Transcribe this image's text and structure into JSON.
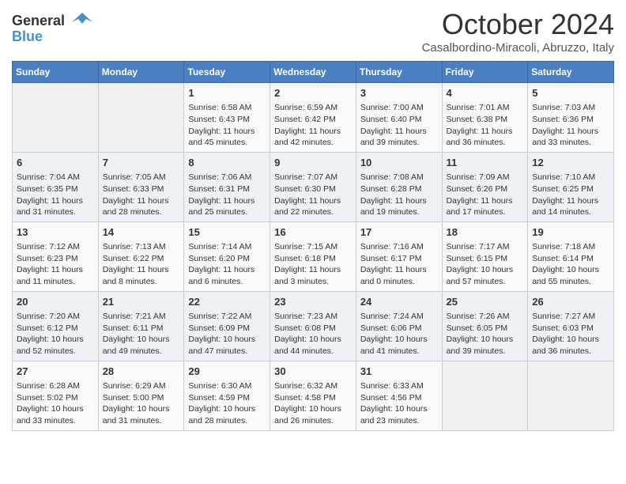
{
  "logo": {
    "general": "General",
    "blue": "Blue"
  },
  "title": "October 2024",
  "subtitle": "Casalbordino-Miracoli, Abruzzo, Italy",
  "days_of_week": [
    "Sunday",
    "Monday",
    "Tuesday",
    "Wednesday",
    "Thursday",
    "Friday",
    "Saturday"
  ],
  "weeks": [
    [
      {
        "day": "",
        "sunrise": "",
        "sunset": "",
        "daylight": ""
      },
      {
        "day": "",
        "sunrise": "",
        "sunset": "",
        "daylight": ""
      },
      {
        "day": "1",
        "sunrise": "Sunrise: 6:58 AM",
        "sunset": "Sunset: 6:43 PM",
        "daylight": "Daylight: 11 hours and 45 minutes."
      },
      {
        "day": "2",
        "sunrise": "Sunrise: 6:59 AM",
        "sunset": "Sunset: 6:42 PM",
        "daylight": "Daylight: 11 hours and 42 minutes."
      },
      {
        "day": "3",
        "sunrise": "Sunrise: 7:00 AM",
        "sunset": "Sunset: 6:40 PM",
        "daylight": "Daylight: 11 hours and 39 minutes."
      },
      {
        "day": "4",
        "sunrise": "Sunrise: 7:01 AM",
        "sunset": "Sunset: 6:38 PM",
        "daylight": "Daylight: 11 hours and 36 minutes."
      },
      {
        "day": "5",
        "sunrise": "Sunrise: 7:03 AM",
        "sunset": "Sunset: 6:36 PM",
        "daylight": "Daylight: 11 hours and 33 minutes."
      }
    ],
    [
      {
        "day": "6",
        "sunrise": "Sunrise: 7:04 AM",
        "sunset": "Sunset: 6:35 PM",
        "daylight": "Daylight: 11 hours and 31 minutes."
      },
      {
        "day": "7",
        "sunrise": "Sunrise: 7:05 AM",
        "sunset": "Sunset: 6:33 PM",
        "daylight": "Daylight: 11 hours and 28 minutes."
      },
      {
        "day": "8",
        "sunrise": "Sunrise: 7:06 AM",
        "sunset": "Sunset: 6:31 PM",
        "daylight": "Daylight: 11 hours and 25 minutes."
      },
      {
        "day": "9",
        "sunrise": "Sunrise: 7:07 AM",
        "sunset": "Sunset: 6:30 PM",
        "daylight": "Daylight: 11 hours and 22 minutes."
      },
      {
        "day": "10",
        "sunrise": "Sunrise: 7:08 AM",
        "sunset": "Sunset: 6:28 PM",
        "daylight": "Daylight: 11 hours and 19 minutes."
      },
      {
        "day": "11",
        "sunrise": "Sunrise: 7:09 AM",
        "sunset": "Sunset: 6:26 PM",
        "daylight": "Daylight: 11 hours and 17 minutes."
      },
      {
        "day": "12",
        "sunrise": "Sunrise: 7:10 AM",
        "sunset": "Sunset: 6:25 PM",
        "daylight": "Daylight: 11 hours and 14 minutes."
      }
    ],
    [
      {
        "day": "13",
        "sunrise": "Sunrise: 7:12 AM",
        "sunset": "Sunset: 6:23 PM",
        "daylight": "Daylight: 11 hours and 11 minutes."
      },
      {
        "day": "14",
        "sunrise": "Sunrise: 7:13 AM",
        "sunset": "Sunset: 6:22 PM",
        "daylight": "Daylight: 11 hours and 8 minutes."
      },
      {
        "day": "15",
        "sunrise": "Sunrise: 7:14 AM",
        "sunset": "Sunset: 6:20 PM",
        "daylight": "Daylight: 11 hours and 6 minutes."
      },
      {
        "day": "16",
        "sunrise": "Sunrise: 7:15 AM",
        "sunset": "Sunset: 6:18 PM",
        "daylight": "Daylight: 11 hours and 3 minutes."
      },
      {
        "day": "17",
        "sunrise": "Sunrise: 7:16 AM",
        "sunset": "Sunset: 6:17 PM",
        "daylight": "Daylight: 11 hours and 0 minutes."
      },
      {
        "day": "18",
        "sunrise": "Sunrise: 7:17 AM",
        "sunset": "Sunset: 6:15 PM",
        "daylight": "Daylight: 10 hours and 57 minutes."
      },
      {
        "day": "19",
        "sunrise": "Sunrise: 7:18 AM",
        "sunset": "Sunset: 6:14 PM",
        "daylight": "Daylight: 10 hours and 55 minutes."
      }
    ],
    [
      {
        "day": "20",
        "sunrise": "Sunrise: 7:20 AM",
        "sunset": "Sunset: 6:12 PM",
        "daylight": "Daylight: 10 hours and 52 minutes."
      },
      {
        "day": "21",
        "sunrise": "Sunrise: 7:21 AM",
        "sunset": "Sunset: 6:11 PM",
        "daylight": "Daylight: 10 hours and 49 minutes."
      },
      {
        "day": "22",
        "sunrise": "Sunrise: 7:22 AM",
        "sunset": "Sunset: 6:09 PM",
        "daylight": "Daylight: 10 hours and 47 minutes."
      },
      {
        "day": "23",
        "sunrise": "Sunrise: 7:23 AM",
        "sunset": "Sunset: 6:08 PM",
        "daylight": "Daylight: 10 hours and 44 minutes."
      },
      {
        "day": "24",
        "sunrise": "Sunrise: 7:24 AM",
        "sunset": "Sunset: 6:06 PM",
        "daylight": "Daylight: 10 hours and 41 minutes."
      },
      {
        "day": "25",
        "sunrise": "Sunrise: 7:26 AM",
        "sunset": "Sunset: 6:05 PM",
        "daylight": "Daylight: 10 hours and 39 minutes."
      },
      {
        "day": "26",
        "sunrise": "Sunrise: 7:27 AM",
        "sunset": "Sunset: 6:03 PM",
        "daylight": "Daylight: 10 hours and 36 minutes."
      }
    ],
    [
      {
        "day": "27",
        "sunrise": "Sunrise: 6:28 AM",
        "sunset": "Sunset: 5:02 PM",
        "daylight": "Daylight: 10 hours and 33 minutes."
      },
      {
        "day": "28",
        "sunrise": "Sunrise: 6:29 AM",
        "sunset": "Sunset: 5:00 PM",
        "daylight": "Daylight: 10 hours and 31 minutes."
      },
      {
        "day": "29",
        "sunrise": "Sunrise: 6:30 AM",
        "sunset": "Sunset: 4:59 PM",
        "daylight": "Daylight: 10 hours and 28 minutes."
      },
      {
        "day": "30",
        "sunrise": "Sunrise: 6:32 AM",
        "sunset": "Sunset: 4:58 PM",
        "daylight": "Daylight: 10 hours and 26 minutes."
      },
      {
        "day": "31",
        "sunrise": "Sunrise: 6:33 AM",
        "sunset": "Sunset: 4:56 PM",
        "daylight": "Daylight: 10 hours and 23 minutes."
      },
      {
        "day": "",
        "sunrise": "",
        "sunset": "",
        "daylight": ""
      },
      {
        "day": "",
        "sunrise": "",
        "sunset": "",
        "daylight": ""
      }
    ]
  ]
}
